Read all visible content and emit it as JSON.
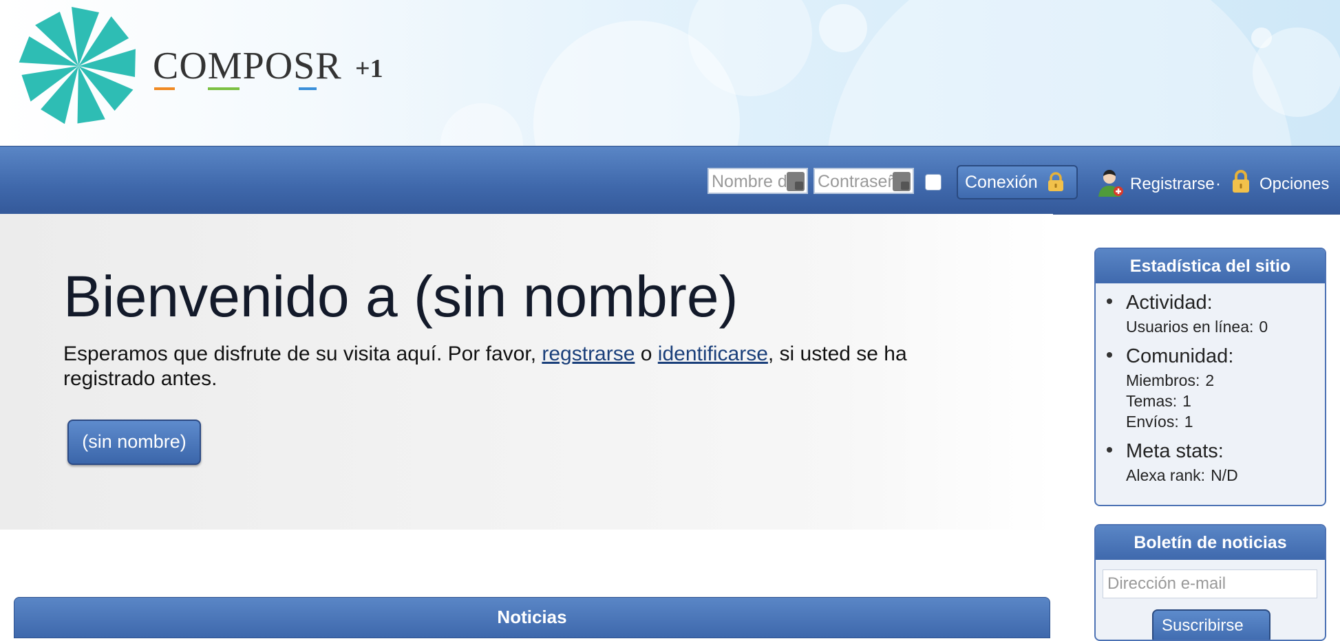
{
  "brand": {
    "logo_text": "COMPOSR",
    "logo_suffix": "+1",
    "accent_colors": [
      "#f08a24",
      "#7cc043",
      "#3a8fd9"
    ],
    "logo_color": "#2ebdb4"
  },
  "login_bar": {
    "username_placeholder": "Nombre del",
    "password_placeholder": "Contraseña",
    "login_label": "Conexión",
    "register_label": "Registrarse",
    "separator": "·",
    "options_label": "Opciones"
  },
  "hero": {
    "title": "Bienvenido a (sin nombre)",
    "text_before": "Esperamos que disfrute de su visita aquí. Por favor,",
    "register_link": "regstrarse",
    "middle": "o",
    "login_link": "identificarse",
    "text_after": ", si usted se ha registrado antes.",
    "button_label": "(sin nombre)"
  },
  "news": {
    "title": "Noticias"
  },
  "site_stats": {
    "title": "Estadística del sitio",
    "groups": [
      {
        "title": "Actividad:",
        "rows": [
          {
            "label": "Usuarios en línea:",
            "value": "0"
          }
        ]
      },
      {
        "title": "Comunidad:",
        "rows": [
          {
            "label": "Miembros:",
            "value": "2"
          },
          {
            "label": "Temas:",
            "value": "1"
          },
          {
            "label": "Envíos:",
            "value": "1"
          }
        ]
      },
      {
        "title": "Meta stats:",
        "rows": [
          {
            "label": "Alexa rank:",
            "value": "N/D"
          }
        ]
      }
    ]
  },
  "newsletter": {
    "title": "Boletín de noticias",
    "email_placeholder": "Dirección e-mail",
    "subscribe_label": "Suscribirse"
  }
}
